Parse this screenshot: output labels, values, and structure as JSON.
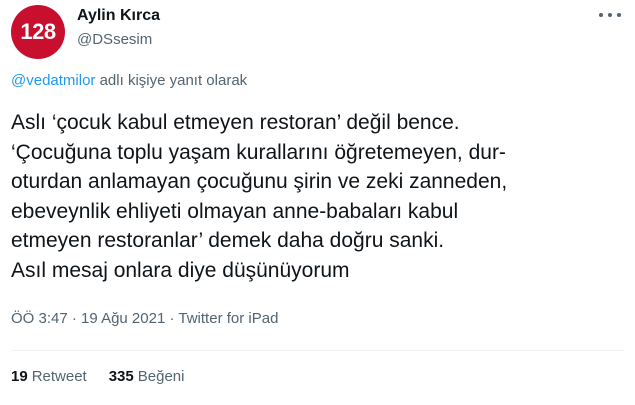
{
  "author": {
    "avatar_text": "128",
    "display_name": "Aylin Kırca",
    "handle": "@DSsesim"
  },
  "reply": {
    "mention": "@vedatmilor",
    "suffix": "adlı kişiye yanıt olarak"
  },
  "tweet": {
    "lines": [
      "Aslı ‘çocuk kabul etmeyen restoran’ değil bence.",
      "‘Çocuğuna toplu yaşam kurallarını öğretemeyen, dur-",
      "oturdan anlamayan çocuğunu şirin ve zeki zanneden,",
      "ebeveynlik ehliyeti olmayan anne-babaları kabul",
      "etmeyen restoranlar’ demek daha doğru sanki.",
      "Asıl mesaj onlara diye düşünüyorum"
    ]
  },
  "meta": {
    "time": "ÖÖ 3:47",
    "separator": "·",
    "date": "19 Ağu 2021",
    "source": "Twitter for iPad"
  },
  "stats": {
    "retweets_count": "19",
    "retweets_label": "Retweet",
    "likes_count": "335",
    "likes_label": "Beğeni"
  },
  "icons": {
    "more": "more-horizontal-icon"
  },
  "colors": {
    "avatar_bg": "#c8102e",
    "link": "#1d9bf0",
    "secondary_text": "#536471",
    "primary_text": "#0f1419"
  }
}
